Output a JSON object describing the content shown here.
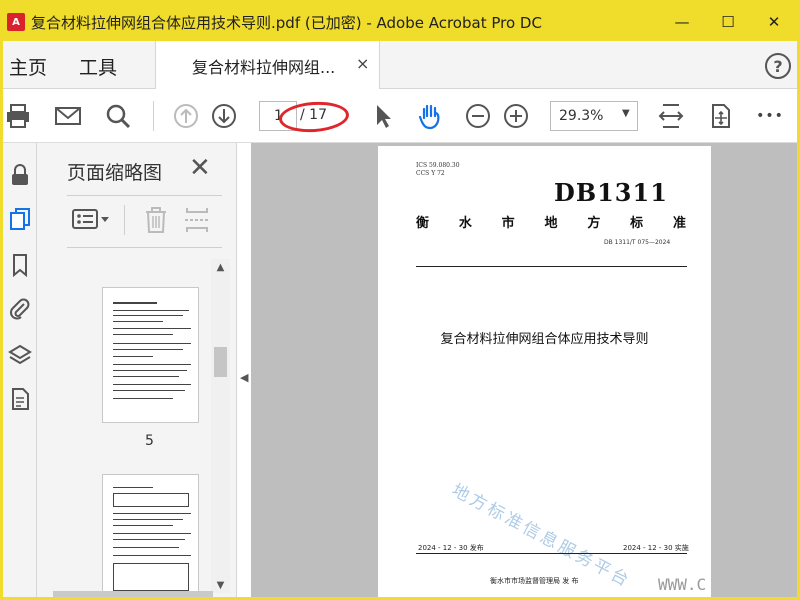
{
  "window": {
    "title": "复合材料拉伸网组合体应用技术导则.pdf  (已加密)  - Adobe Acrobat Pro DC",
    "app_icon_text": "A",
    "controls": [
      "—",
      "☐",
      "✕"
    ]
  },
  "menu": {
    "home": "主页",
    "tools": "工具",
    "doc_tab_label": "复合材料拉伸网组...",
    "doc_tab_close": "×",
    "help": "?"
  },
  "toolbar": {
    "current_page": "1",
    "page_total": "/ 17",
    "zoom": "29.3%",
    "zoom_caret": "▼",
    "more": "•••"
  },
  "panel": {
    "title": "页面缩略图",
    "close": "✕",
    "thumb_page_label": "5"
  },
  "scroll": {
    "up": "▲",
    "down": "▼",
    "collapse": "◀"
  },
  "document": {
    "ics": "ICS  59.080.30",
    "ccs": "CCS  Y 72",
    "db": "DB1311",
    "org_chars": [
      "衡",
      "水",
      "市",
      "地",
      "方",
      "标",
      "准"
    ],
    "code": "DB 1311/T 075—2024",
    "title": "复合材料拉伸网组合体应用技术导则",
    "watermark": "地方标准信息服务平台",
    "publish_date": "2024 - 12 - 30 发布",
    "implement_date": "2024 - 12 - 30 实施",
    "issuer": "衡水市市场监督管理局     发  布"
  },
  "site_watermark": "WWW.C",
  "colors": {
    "titlebar": "#f0dc2a",
    "accent": "#1473e6",
    "annotation": "#e0262b"
  }
}
